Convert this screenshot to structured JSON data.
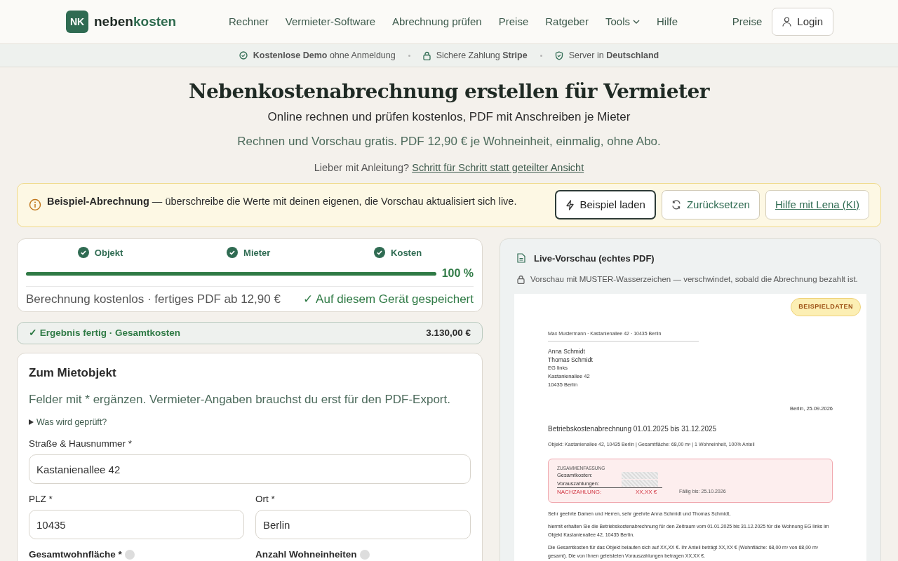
{
  "nav": {
    "logo_mark": "NK",
    "logo_first": "neben",
    "logo_second": "kosten",
    "links": [
      {
        "label": "Rechner",
        "dropdown": false
      },
      {
        "label": "Vermieter-Software",
        "dropdown": false
      },
      {
        "label": "Abrechnung prüfen",
        "dropdown": false
      },
      {
        "label": "Preise",
        "dropdown": false
      },
      {
        "label": "Ratgeber",
        "dropdown": false
      },
      {
        "label": "Tools",
        "dropdown": true
      },
      {
        "label": "Hilfe",
        "dropdown": false
      }
    ],
    "right_link": "Preise",
    "login": "Login"
  },
  "trust": [
    {
      "kind": "check",
      "text": "**Kostenlose Demo** ohne Anmeldung"
    },
    {
      "kind": "lock",
      "text": "Sichere Zahlung **Stripe**"
    },
    {
      "kind": "shield",
      "text": "Server in **Deutschland**"
    }
  ],
  "hero": {
    "title": "Nebenkostenabrechnung erstellen für Vermieter",
    "subtitle": "Online rechnen und prüfen kostenlos, PDF mit Anschreiben je Mieter",
    "note": "Rechnen und Vorschau gratis. PDF 12,90 € je Wohneinheit, einmalig, ohne Abo.",
    "guide_prefix": "Lieber mit Anleitung?",
    "guide_link": "Schritt für Schritt statt geteilter Ansicht"
  },
  "notice": {
    "text": "**Beispiel-Abrechnung** — überschreibe die Werte mit deinen eigenen, die Vorschau aktualisiert sich live.",
    "buttons": [
      {
        "kind": "primary",
        "label": "Beispiel laden"
      },
      {
        "kind": "secondary",
        "label": "Zurücksetzen"
      },
      {
        "kind": "link",
        "label": "Hilfe mit Lena (KI)"
      }
    ]
  },
  "progress": {
    "steps": [
      {
        "label": "Objekt",
        "done": true
      },
      {
        "label": "Mieter",
        "done": true
      },
      {
        "label": "Kosten",
        "done": true
      }
    ],
    "level": 1,
    "percent": "100 %",
    "footer_left": "Berechnung kostenlos · fertiges PDF ab 12,90 €",
    "footer_right": "✓ Auf diesem Gerät gespeichert"
  },
  "result": {
    "label": "✓ Ergebnis fertig · Gesamtkosten",
    "value": "3.130,00 €"
  },
  "form": {
    "title": "Zum Mietobjekt",
    "intro": "Felder mit * ergänzen. Vermieter-Angaben brauchst du erst für den PDF-Export.",
    "details": "Was wird geprüft?",
    "fields": [
      {
        "label": "Straße & Hausnummer *",
        "value": "Kastanienallee 42",
        "wide": true
      },
      {
        "label": "PLZ *",
        "value": "10435",
        "wide": false
      },
      {
        "label": "Ort *",
        "value": "Berlin",
        "wide": false
      }
    ],
    "next_labels": [
      "Gesamtwohnfläche *",
      "Anzahl Wohneinheiten"
    ]
  },
  "preview": {
    "title": "Live-Vorschau (echtes PDF)",
    "note": "Vorschau mit MUSTER-Wasserzeichen — verschwindet, sobald die Abrechnung bezahlt ist.",
    "badge": "BEISPIELDATEN",
    "document": {
      "sender": "Max Mustermann · Kastanienallee 42 · 10435 Berlin",
      "recipient": [
        "Anna Schmidt",
        "Thomas Schmidt",
        "EG links",
        "Kastanienallee 42",
        "10435 Berlin"
      ],
      "date": "Berlin, 25.09.2026",
      "heading": "Betriebskostenabrechnung 01.01.2025 bis 31.12.2025",
      "object_line": "Objekt: Kastanienallee 42, 10435 Berlin  |  Gesamtfläche: 68,00 m²  |  1 Wohneinheit, 100% Anteil",
      "summary": {
        "title": "ZUSAMMENFASSUNG",
        "rows": [
          "Gesamtkosten:",
          "Vorauszahlungen:"
        ],
        "total_label": "NACHZAHLUNG:",
        "total_value": "XX,XX €",
        "due": "Fällig bis: 25.10.2026"
      },
      "paragraphs": [
        "Sehr geehrte Damen und Herren, sehr geehrte Anna Schmidt und Thomas Schmidt,",
        "hiermit erhalten Sie die Betriebskostenabrechnung für den Zeitraum vom 01.01.2025 bis 31.12.2025 für die Wohnung EG links im Objekt Kastanienallee 42, 10435 Berlin.",
        "Die Gesamtkosten für das Objekt belaufen sich auf XX,XX €. Ihr Anteil beträgt XX,XX € (Wohnfläche: 68,00 m² von 68,00 m² gesamt). Die von Ihnen geleisteten Vorauszahlungen betragen XX,XX €."
      ]
    }
  }
}
